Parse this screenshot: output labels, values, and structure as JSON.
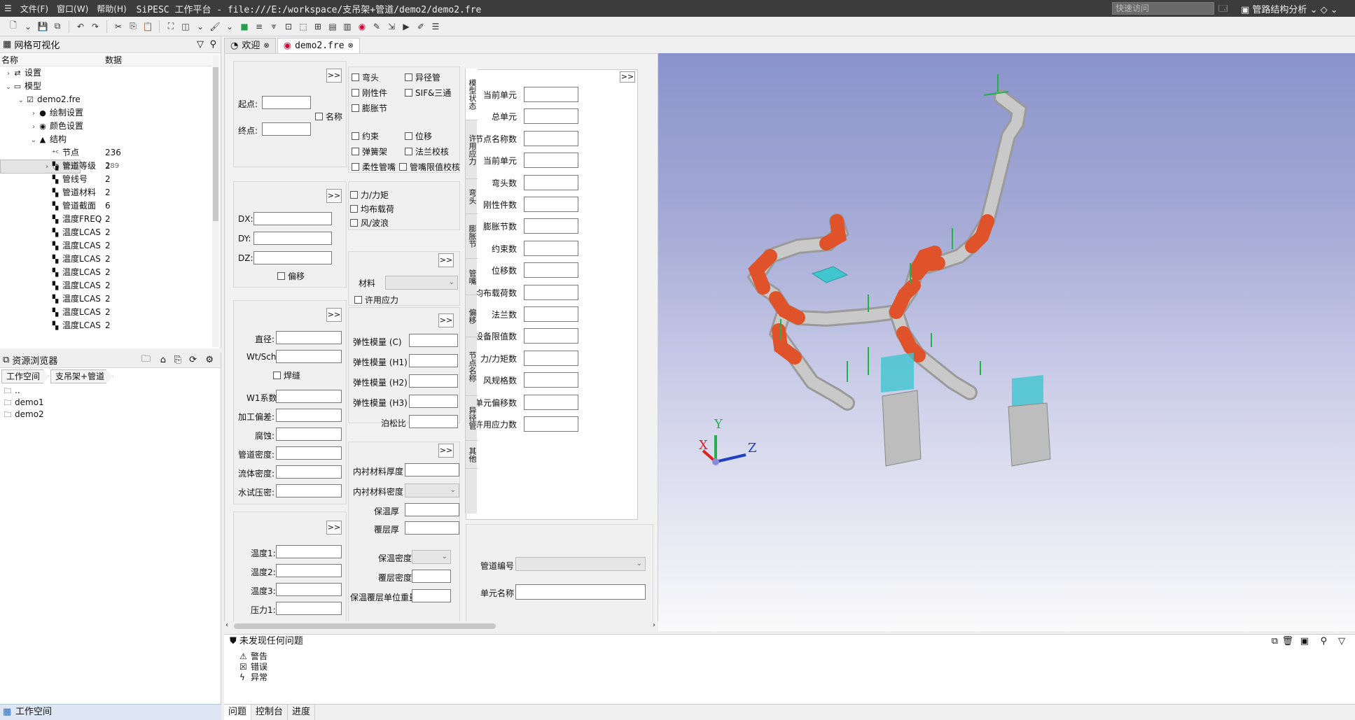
{
  "window": {
    "menu": [
      "文件(F)",
      "窗口(W)",
      "帮助(H)"
    ],
    "title": "SiPESC 工作平台 - file:///E:/workspace/支吊架+管道/demo2/demo2.fre",
    "quick_access_placeholder": "快速访问",
    "perspective": "管路结构分析"
  },
  "mesh_pane": {
    "title": "网格可视化",
    "columns": [
      "名称",
      "数据"
    ],
    "rows": [
      {
        "label": "设置",
        "value": "",
        "icon": "settings-icon"
      },
      {
        "label": "模型",
        "value": "",
        "icon": "model-icon"
      },
      {
        "label": "demo2.fre",
        "value": "",
        "icon": "checkbox-icon"
      },
      {
        "label": "绘制设置",
        "value": "",
        "icon": "draw-settings-icon"
      },
      {
        "label": "颜色设置",
        "value": "",
        "icon": "color-settings-icon"
      },
      {
        "label": "结构",
        "value": "",
        "icon": "structure-icon"
      },
      {
        "label": "节点",
        "value": "236",
        "icon": "node-icon"
      },
      {
        "label": "单元",
        "value": "189",
        "icon": "element-icon"
      },
      {
        "label": "管道等级",
        "value": "2",
        "icon": "pipe-icon"
      },
      {
        "label": "管线号",
        "value": "2",
        "icon": "pipe-icon"
      },
      {
        "label": "管道材料",
        "value": "2",
        "icon": "pipe-icon"
      },
      {
        "label": "管道截面",
        "value": "6",
        "icon": "pipe-icon"
      },
      {
        "label": "温度FREQ",
        "value": "2",
        "icon": "pipe-icon"
      },
      {
        "label": "温度LCAS",
        "value": "2",
        "icon": "pipe-icon"
      },
      {
        "label": "温度LCAS",
        "value": "2",
        "icon": "pipe-icon"
      },
      {
        "label": "温度LCAS",
        "value": "2",
        "icon": "pipe-icon"
      },
      {
        "label": "温度LCAS",
        "value": "2",
        "icon": "pipe-icon"
      },
      {
        "label": "温度LCAS",
        "value": "2",
        "icon": "pipe-icon"
      },
      {
        "label": "温度LCAS",
        "value": "2",
        "icon": "pipe-icon"
      },
      {
        "label": "温度LCAS",
        "value": "2",
        "icon": "pipe-icon"
      },
      {
        "label": "温度LCAS",
        "value": "2",
        "icon": "pipe-icon"
      }
    ]
  },
  "resource_pane": {
    "title": "资源浏览器",
    "breadcrumb": [
      "工作空间",
      "支吊架+管道"
    ],
    "items": [
      "..",
      "demo1",
      "demo2"
    ]
  },
  "workspace_bar": "工作空间",
  "editor_tabs": [
    {
      "label": "欢迎",
      "active": false
    },
    {
      "label": "demo2.fre",
      "active": true
    }
  ],
  "form": {
    "more": ">>",
    "start_label": "起点:",
    "end_label": "终点:",
    "name_label": "名称",
    "dx": "DX:",
    "dy": "DY:",
    "dz": "DZ:",
    "offset_label": "偏移",
    "diameter": "直径:",
    "wtsch": "Wt/Sch:",
    "weld_label": "焊缝",
    "w1": "W1系数:",
    "tolerance": "加工偏差:",
    "corrosion": "腐蚀:",
    "pipe_density": "管道密度:",
    "fluid_density": "流体密度:",
    "hydro_pressure": "水试压密:",
    "temp1": "温度1:",
    "temp2": "温度2:",
    "temp3": "温度3:",
    "pressure1": "压力1:",
    "cb_group1": [
      "弯头",
      "异径管",
      "刚性件",
      "SIF&三通",
      "膨胀节"
    ],
    "cb_group2": [
      "约束",
      "位移",
      "弹簧架",
      "法兰校核",
      "柔性管嘴",
      "管嘴限值校核"
    ],
    "cb_group3": [
      "力/力矩",
      "均布载荷",
      "风/波浪"
    ],
    "material_label": "材料",
    "allowable_stress_label": "许用应力",
    "modulus": [
      "弹性模量 (C)",
      "弹性模量 (H1)",
      "弹性模量 (H2)",
      "弹性模量 (H3)",
      "泊松比"
    ],
    "lining_thickness": "内衬材料厚度",
    "lining_density": "内衬材料密度",
    "insulation_thickness": "保温厚",
    "cladding_thickness": "覆层厚",
    "insulation_density": "保温密度",
    "cladding_density": "覆层密度",
    "insul_clad_weight": "保温覆层单位重量",
    "vtabs": [
      "模型状态",
      "许用应力",
      "弯头",
      "膨胀节",
      "管嘴",
      "偏移",
      "节点名称",
      "异径管",
      "其他"
    ],
    "status_fields": [
      "当前单元",
      "总单元",
      "节点名称数",
      "当前单元",
      "弯头数",
      "刚性件数",
      "膨胀节数",
      "约束数",
      "位移数",
      "均布载荷数",
      "法兰数",
      "设备限值数",
      "力/力矩数",
      "风规格数",
      "单元偏移数",
      "许用应力数"
    ],
    "pipe_no_label": "管道编号",
    "element_name_label": "单元名称"
  },
  "axes": {
    "x": "X",
    "y": "Y",
    "z": "Z"
  },
  "colors": {
    "pipe": "#bdbdbd",
    "bend": "#e0522a",
    "support": "#3fc6cf",
    "restraint": "#22b14c"
  },
  "problems": {
    "title": "未发现任何问题",
    "items": [
      {
        "label": "警告",
        "icon": "warning-icon"
      },
      {
        "label": "错误",
        "icon": "error-icon"
      },
      {
        "label": "异常",
        "icon": "exception-icon"
      }
    ]
  },
  "bottom_tabs": [
    "问题",
    "控制台",
    "进度"
  ]
}
